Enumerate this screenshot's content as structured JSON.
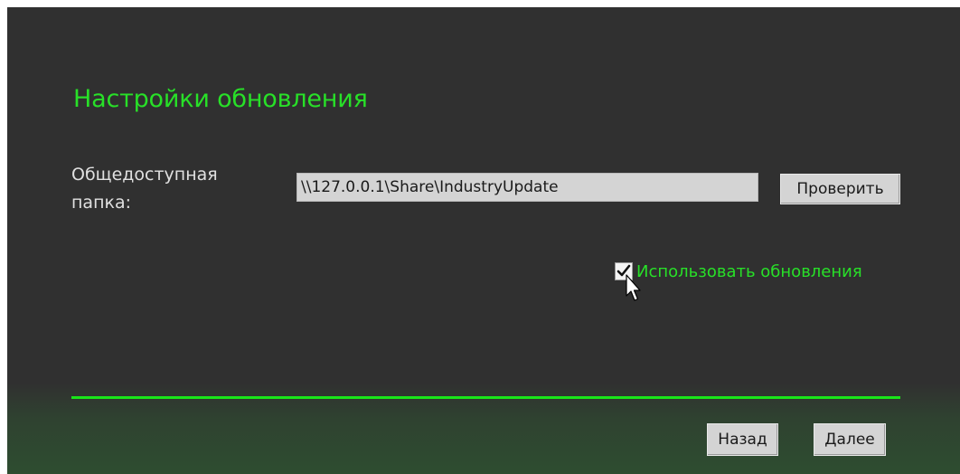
{
  "page": {
    "title": "Настройки обновления"
  },
  "shared_folder": {
    "label": "Общедоступная папка:",
    "value": "\\\\127.0.0.1\\Share\\IndustryUpdate",
    "check_button_label": "Проверить"
  },
  "use_updates": {
    "label": "Использовать обновления",
    "checked": true
  },
  "navigation": {
    "back_label": "Назад",
    "next_label": "Далее"
  },
  "colors": {
    "accent": "#28e028",
    "background": "#303030",
    "divider": "#19e619"
  }
}
